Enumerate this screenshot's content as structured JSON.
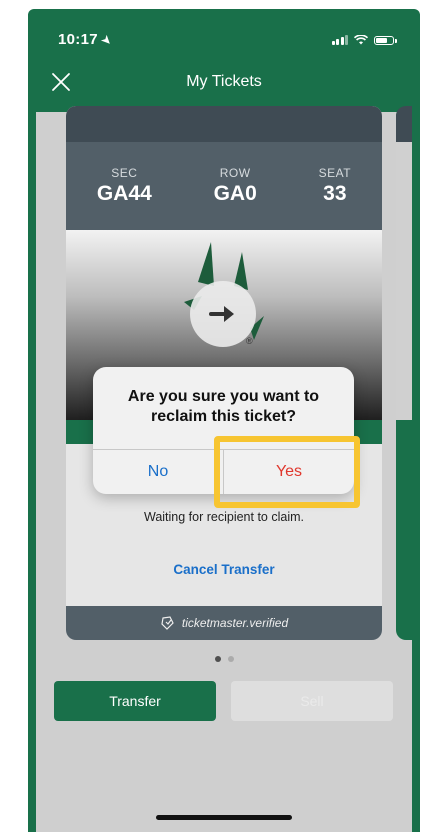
{
  "status_bar": {
    "time": "10:17"
  },
  "header": {
    "title": "My Tickets"
  },
  "ticket": {
    "sec_label": "SEC",
    "sec_value": "GA44",
    "row_label": "ROW",
    "row_value": "GA0",
    "seat_label": "SEAT",
    "seat_value": "33",
    "status_text": "Waiting for recipient to claim.",
    "cancel_label": "Cancel Transfer",
    "verified_text": "ticketmaster.verified"
  },
  "dialog": {
    "message": "Are you sure you want to reclaim this ticket?",
    "no_label": "No",
    "yes_label": "Yes"
  },
  "actions": {
    "transfer_label": "Transfer",
    "sell_label": "Sell"
  },
  "pagination": {
    "current": 1,
    "total": 2
  },
  "colors": {
    "brand_green": "#19704a",
    "link_blue": "#1a6fc9",
    "destructive_red": "#e0372d",
    "highlight_yellow": "#f7c531"
  }
}
